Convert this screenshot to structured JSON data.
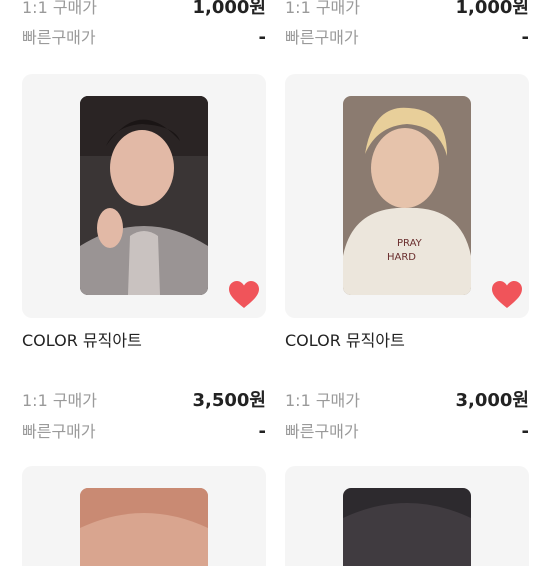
{
  "top_row": {
    "left": {
      "one_to_one_label": "1:1 구매가",
      "one_to_one_price": "1,000원",
      "quick_label": "빠른구매가",
      "quick_price": "-"
    },
    "right": {
      "one_to_one_label": "1:1 구매가",
      "one_to_one_price": "1,000원",
      "quick_label": "빠른구매가",
      "quick_price": "-"
    }
  },
  "products": [
    {
      "title": "COLOR 뮤직아트",
      "one_to_one_label": "1:1 구매가",
      "one_to_one_price": "3,500원",
      "quick_label": "빠른구매가",
      "quick_price": "-",
      "liked": true,
      "heart_icon": "heart-filled-icon",
      "heart_color": "#f0545a"
    },
    {
      "title": "COLOR 뮤직아트",
      "one_to_one_label": "1:1 구매가",
      "one_to_one_price": "3,000원",
      "quick_label": "빠른구매가",
      "quick_price": "-",
      "liked": true,
      "heart_icon": "heart-filled-icon",
      "heart_color": "#f0545a"
    }
  ],
  "colors": {
    "card_background": "#f5f5f5",
    "label_gray": "#9a9a9a",
    "text_dark": "#222222",
    "heart_red": "#f0545a"
  }
}
